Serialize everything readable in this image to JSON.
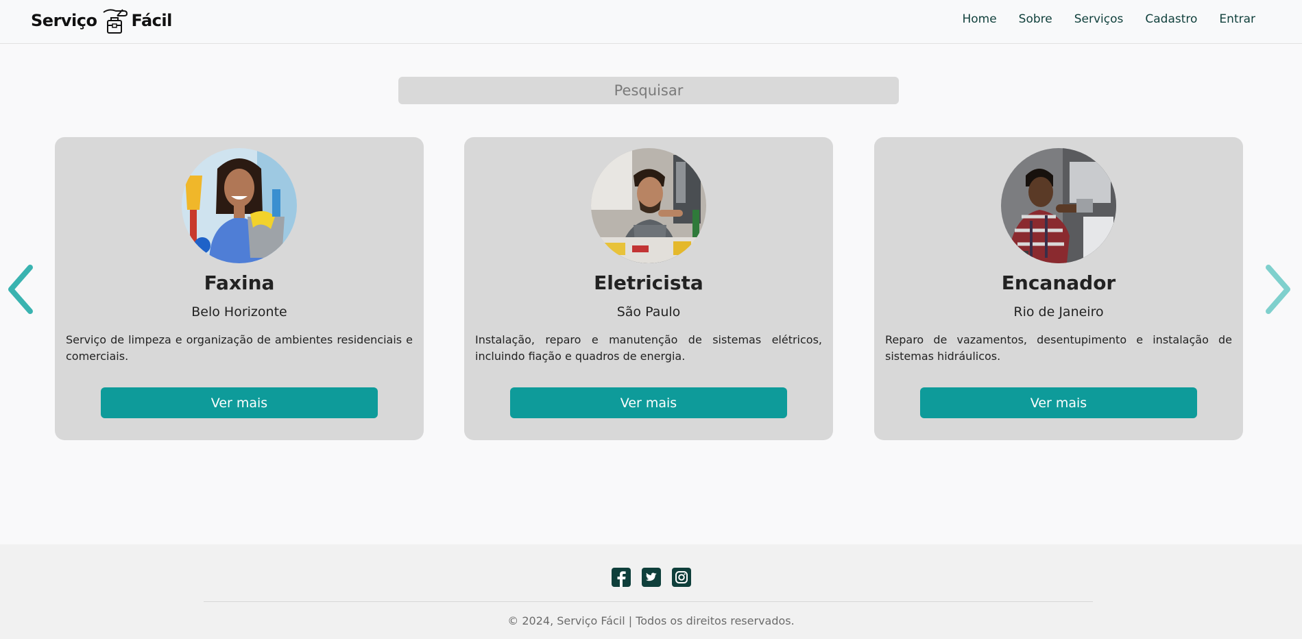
{
  "brand": {
    "name_left": "Serviço",
    "name_right": "Fácil",
    "logo_icon": "toolbox-hand-icon"
  },
  "nav": {
    "items": [
      {
        "label": "Home"
      },
      {
        "label": "Sobre"
      },
      {
        "label": "Serviços"
      },
      {
        "label": "Cadastro"
      },
      {
        "label": "Entrar"
      }
    ],
    "color": "#0f3f3b"
  },
  "search": {
    "placeholder": "Pesquisar"
  },
  "carousel": {
    "prev_icon": "chevron-left-icon",
    "next_icon": "chevron-right-icon",
    "arrow_color": "#3ab3b0",
    "cards": [
      {
        "title": "Faxina",
        "city": "Belo Horizonte",
        "description": "Serviço de limpeza e organização de ambientes residenciais e comerciais.",
        "button": "Ver mais",
        "photo": "cleaner-photo"
      },
      {
        "title": "Eletricista",
        "city": "São Paulo",
        "description": "Instalação, reparo e manutenção de sistemas elétricos, incluindo fiação e quadros de energia.",
        "button": "Ver mais",
        "photo": "electrician-photo"
      },
      {
        "title": "Encanador",
        "city": "Rio de Janeiro",
        "description": "Reparo de vazamentos, desentupimento e instalação de sistemas hidráulicos.",
        "button": "Ver mais",
        "photo": "plumber-photo"
      }
    ],
    "button_color": "#0e9b9a",
    "card_color": "#d8d8d8"
  },
  "footer": {
    "social": [
      "facebook-icon",
      "twitter-icon",
      "instagram-icon"
    ],
    "social_color": "#0f3f3b",
    "copyright": "© 2024, Serviço Fácil | Todos os direitos reservados."
  }
}
